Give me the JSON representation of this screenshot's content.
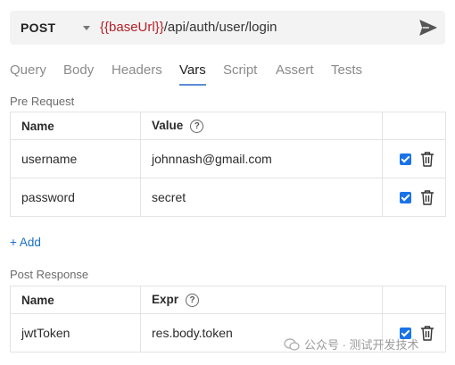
{
  "request": {
    "method": "POST",
    "url_variable": "{{baseUrl}}",
    "url_path": "/api/auth/user/login"
  },
  "tabs": [
    {
      "label": "Query",
      "active": false
    },
    {
      "label": "Body",
      "active": false
    },
    {
      "label": "Headers",
      "active": false
    },
    {
      "label": "Vars",
      "active": true
    },
    {
      "label": "Script",
      "active": false
    },
    {
      "label": "Assert",
      "active": false
    },
    {
      "label": "Tests",
      "active": false
    }
  ],
  "pre_request": {
    "section_label": "Pre Request",
    "columns": {
      "name": "Name",
      "value": "Value"
    },
    "rows": [
      {
        "name": "username",
        "value": "johnnash@gmail.com",
        "enabled": true
      },
      {
        "name": "password",
        "value": "secret",
        "enabled": true
      }
    ],
    "add_label": "+ Add"
  },
  "post_response": {
    "section_label": "Post Response",
    "columns": {
      "name": "Name",
      "expr": "Expr"
    },
    "rows": [
      {
        "name": "jwtToken",
        "expr": "res.body.token",
        "enabled": true
      }
    ]
  },
  "watermark": {
    "text": "公众号 · 测试开发技术"
  },
  "colors": {
    "accent": "#1a73e8",
    "url_variable": "#b5222a",
    "tab_underline": "#5a8dd6",
    "link": "#1a6fc4"
  },
  "icons": {
    "send": "send-icon",
    "help": "help-circle-icon",
    "delete": "trash-icon",
    "dropdown": "chevron-down-icon"
  }
}
